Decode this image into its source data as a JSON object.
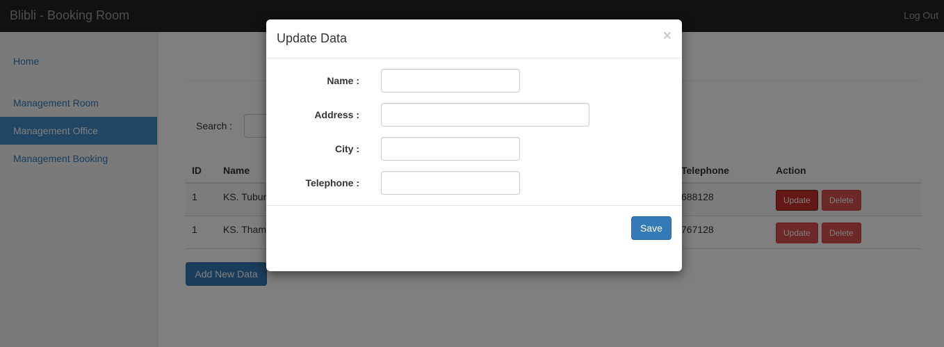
{
  "navbar": {
    "brand": "Blibli - Booking Room",
    "logout": "Log Out"
  },
  "sidebar": {
    "items": [
      {
        "label": "Home",
        "active": false
      },
      {
        "label": "Management Room",
        "active": false
      },
      {
        "label": "Management Office",
        "active": true
      },
      {
        "label": "Management Booking",
        "active": false
      }
    ]
  },
  "main": {
    "search_label": "Search :",
    "table": {
      "headers": {
        "id": "ID",
        "name": "Name",
        "telephone": "Telephone",
        "action": "Action"
      },
      "rows": [
        {
          "id": "1",
          "name": "KS. Tubun",
          "telephone": "688128",
          "update": "Update",
          "delete": "Delete"
        },
        {
          "id": "1",
          "name": "KS. Tham",
          "telephone": "767128",
          "update": "Update",
          "delete": "Delete"
        }
      ]
    },
    "add_button": "Add New Data"
  },
  "modal": {
    "title": "Update Data",
    "close": "×",
    "fields": {
      "name": {
        "label": "Name :",
        "value": ""
      },
      "address": {
        "label": "Address :",
        "value": ""
      },
      "city": {
        "label": "City :",
        "value": ""
      },
      "telephone": {
        "label": "Telephone :",
        "value": ""
      }
    },
    "save": "Save"
  },
  "colors": {
    "primary": "#337ab7",
    "danger": "#d9534f",
    "navbar": "#222222",
    "sidebar_active": "#428bca"
  }
}
